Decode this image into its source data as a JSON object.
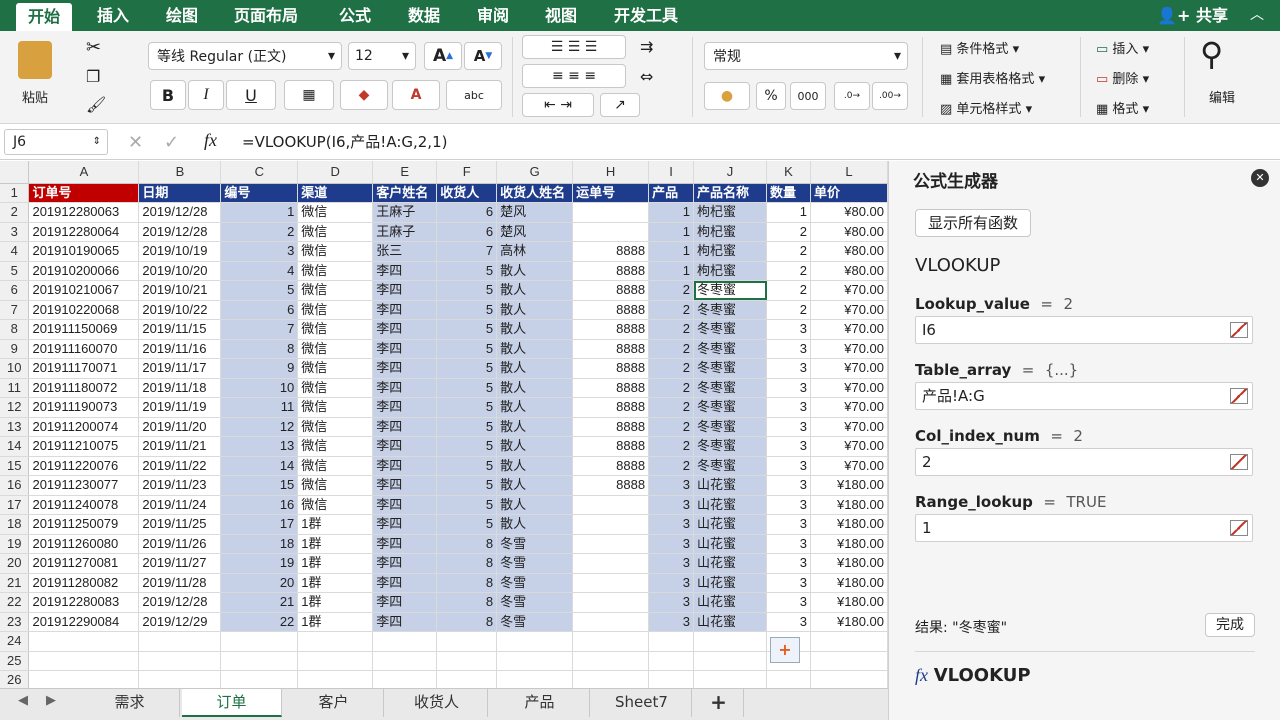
{
  "menu": [
    "开始",
    "插入",
    "绘图",
    "页面布局",
    "公式",
    "数据",
    "审阅",
    "视图",
    "开发工具"
  ],
  "share": "共享",
  "ribbon": {
    "paste": "粘贴",
    "font_name": "等线 Regular (正文)",
    "font_size": "12",
    "number_format": "常规",
    "cond_format": "条件格式",
    "table_format": "套用表格格式",
    "cell_style": "单元格样式",
    "insert": "插入",
    "delete": "删除",
    "format": "格式",
    "edit": "编辑",
    "bold": "B",
    "italic": "I",
    "underline": "U",
    "grow": "A",
    "shrink": "A",
    "percent": "%",
    "thousands": "000"
  },
  "formula_bar": {
    "name_box": "J6",
    "fx": "fx",
    "formula": "=VLOOKUP(I6,产品!A:G,2,1)"
  },
  "columns": [
    "A",
    "B",
    "C",
    "D",
    "E",
    "F",
    "G",
    "H",
    "I",
    "J",
    "K",
    "L"
  ],
  "headers": [
    "订单号",
    "日期",
    "编号",
    "渠道",
    "客户姓名",
    "收货人",
    "收货人姓名",
    "运单号",
    "产品",
    "产品名称",
    "数量",
    "单价"
  ],
  "rows": [
    [
      "201912280063",
      "2019/12/28",
      "1",
      "微信",
      "王麻子",
      "6",
      "楚风",
      "",
      "1",
      "枸杞蜜",
      "1",
      "¥80.00"
    ],
    [
      "201912280064",
      "2019/12/28",
      "2",
      "微信",
      "王麻子",
      "6",
      "楚风",
      "",
      "1",
      "枸杞蜜",
      "2",
      "¥80.00"
    ],
    [
      "201910190065",
      "2019/10/19",
      "3",
      "微信",
      "张三",
      "7",
      "高林",
      "8888",
      "1",
      "枸杞蜜",
      "2",
      "¥80.00"
    ],
    [
      "201910200066",
      "2019/10/20",
      "4",
      "微信",
      "李四",
      "5",
      "散人",
      "8888",
      "1",
      "枸杞蜜",
      "2",
      "¥80.00"
    ],
    [
      "201910210067",
      "2019/10/21",
      "5",
      "微信",
      "李四",
      "5",
      "散人",
      "8888",
      "2",
      "冬枣蜜",
      "2",
      "¥70.00"
    ],
    [
      "201910220068",
      "2019/10/22",
      "6",
      "微信",
      "李四",
      "5",
      "散人",
      "8888",
      "2",
      "冬枣蜜",
      "2",
      "¥70.00"
    ],
    [
      "201911150069",
      "2019/11/15",
      "7",
      "微信",
      "李四",
      "5",
      "散人",
      "8888",
      "2",
      "冬枣蜜",
      "3",
      "¥70.00"
    ],
    [
      "201911160070",
      "2019/11/16",
      "8",
      "微信",
      "李四",
      "5",
      "散人",
      "8888",
      "2",
      "冬枣蜜",
      "3",
      "¥70.00"
    ],
    [
      "201911170071",
      "2019/11/17",
      "9",
      "微信",
      "李四",
      "5",
      "散人",
      "8888",
      "2",
      "冬枣蜜",
      "3",
      "¥70.00"
    ],
    [
      "201911180072",
      "2019/11/18",
      "10",
      "微信",
      "李四",
      "5",
      "散人",
      "8888",
      "2",
      "冬枣蜜",
      "3",
      "¥70.00"
    ],
    [
      "201911190073",
      "2019/11/19",
      "11",
      "微信",
      "李四",
      "5",
      "散人",
      "8888",
      "2",
      "冬枣蜜",
      "3",
      "¥70.00"
    ],
    [
      "201911200074",
      "2019/11/20",
      "12",
      "微信",
      "李四",
      "5",
      "散人",
      "8888",
      "2",
      "冬枣蜜",
      "3",
      "¥70.00"
    ],
    [
      "201911210075",
      "2019/11/21",
      "13",
      "微信",
      "李四",
      "5",
      "散人",
      "8888",
      "2",
      "冬枣蜜",
      "3",
      "¥70.00"
    ],
    [
      "201911220076",
      "2019/11/22",
      "14",
      "微信",
      "李四",
      "5",
      "散人",
      "8888",
      "2",
      "冬枣蜜",
      "3",
      "¥70.00"
    ],
    [
      "201911230077",
      "2019/11/23",
      "15",
      "微信",
      "李四",
      "5",
      "散人",
      "8888",
      "3",
      "山花蜜",
      "3",
      "¥180.00"
    ],
    [
      "201911240078",
      "2019/11/24",
      "16",
      "微信",
      "李四",
      "5",
      "散人",
      "",
      "3",
      "山花蜜",
      "3",
      "¥180.00"
    ],
    [
      "201911250079",
      "2019/11/25",
      "17",
      "1群",
      "李四",
      "5",
      "散人",
      "",
      "3",
      "山花蜜",
      "3",
      "¥180.00"
    ],
    [
      "201911260080",
      "2019/11/26",
      "18",
      "1群",
      "李四",
      "8",
      "冬雪",
      "",
      "3",
      "山花蜜",
      "3",
      "¥180.00"
    ],
    [
      "201911270081",
      "2019/11/27",
      "19",
      "1群",
      "李四",
      "8",
      "冬雪",
      "",
      "3",
      "山花蜜",
      "3",
      "¥180.00"
    ],
    [
      "201911280082",
      "2019/11/28",
      "20",
      "1群",
      "李四",
      "8",
      "冬雪",
      "",
      "3",
      "山花蜜",
      "3",
      "¥180.00"
    ],
    [
      "201912280083",
      "2019/12/28",
      "21",
      "1群",
      "李四",
      "8",
      "冬雪",
      "",
      "3",
      "山花蜜",
      "3",
      "¥180.00"
    ],
    [
      "201912290084",
      "2019/12/29",
      "22",
      "1群",
      "李四",
      "8",
      "冬雪",
      "",
      "3",
      "山花蜜",
      "3",
      "¥180.00"
    ]
  ],
  "sheet_tabs": [
    "需求",
    "订单",
    "客户",
    "收货人",
    "产品",
    "Sheet7",
    "+"
  ],
  "active_tab": "订单",
  "panel": {
    "title": "公式生成器",
    "show_all": "显示所有函数",
    "func": "VLOOKUP",
    "args": [
      {
        "name": "Lookup_value",
        "eq": "=",
        "val": "2",
        "input": "I6"
      },
      {
        "name": "Table_array",
        "eq": "=",
        "val": "{...}",
        "input": "产品!A:G"
      },
      {
        "name": "Col_index_num",
        "eq": "=",
        "val": "2",
        "input": "2"
      },
      {
        "name": "Range_lookup",
        "eq": "=",
        "val": "TRUE",
        "input": "1"
      }
    ],
    "result": "结果: \"冬枣蜜\"",
    "done": "完成",
    "footer_fx": "fx",
    "footer_func": "VLOOKUP"
  },
  "colors": {
    "green": "#1f7145",
    "header_fill": "#1f3c8c",
    "header_red": "#c00000",
    "selection": "#c6d0e6"
  }
}
